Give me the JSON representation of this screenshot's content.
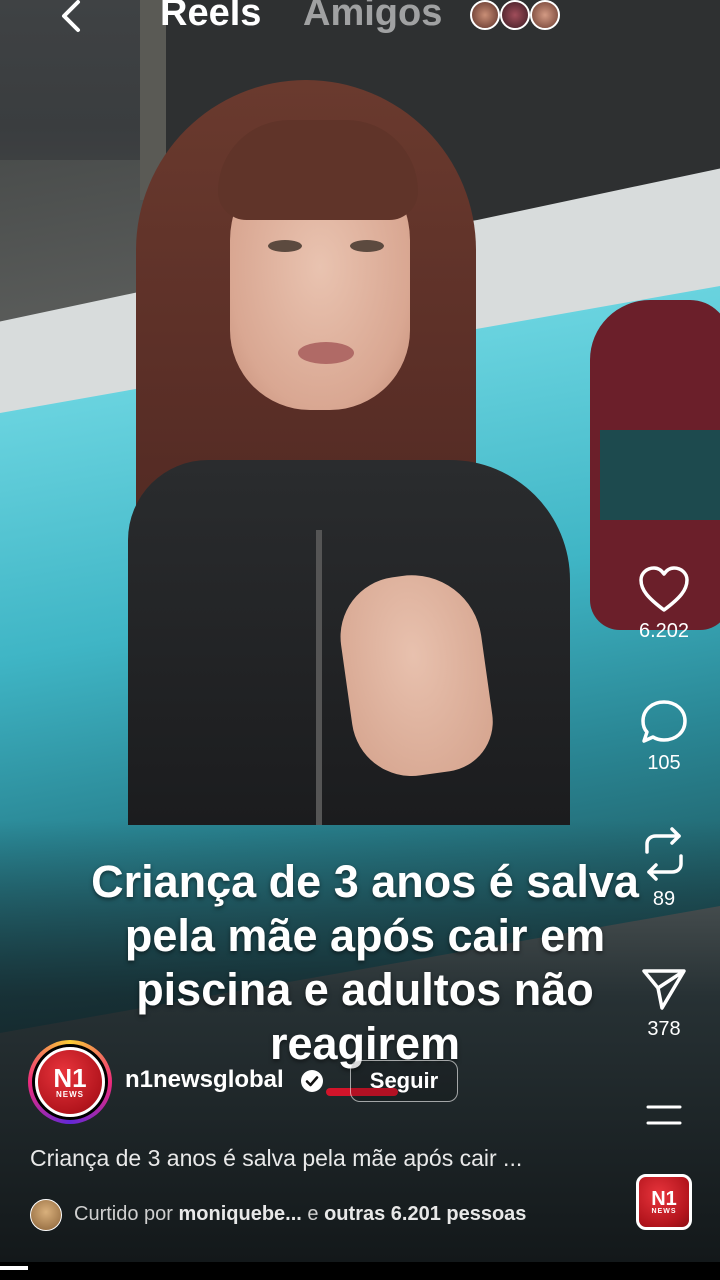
{
  "header": {
    "tabs": [
      {
        "label": "Reels",
        "active": true
      },
      {
        "label": "Amigos",
        "active": false
      }
    ],
    "friend_avatars": 3
  },
  "video": {
    "overlay_title": "Criança de 3 anos é salva pela mãe após cair em piscina e adultos não reagirem"
  },
  "actions": {
    "likes": "6.202",
    "comments": "105",
    "reposts": "89",
    "shares": "378"
  },
  "author": {
    "avatar_text": "N1",
    "avatar_subtext": "NEWS",
    "username": "n1newsglobal",
    "verified": true,
    "follow_label": "Seguir"
  },
  "caption": "Criança de 3 anos é salva pela mãe após cair ...",
  "liked_by": {
    "prefix": "Curtido por",
    "user": "moniquebe...",
    "middle": "e",
    "others": "outras 6.201 pessoas"
  },
  "audio": {
    "thumb_text": "N1",
    "thumb_subtext": "NEWS"
  },
  "colors": {
    "follow_underline": "#d2142a",
    "brand_red": "#b3151d"
  }
}
